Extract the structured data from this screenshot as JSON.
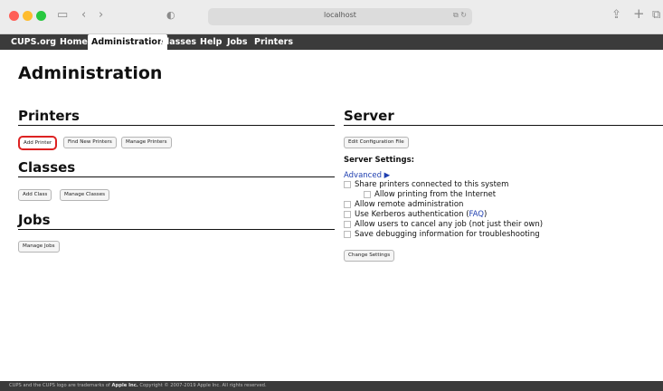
{
  "browser": {
    "url": "localhost",
    "translate_icon": "translate-icon",
    "reload_icon": "reload-icon"
  },
  "nav": {
    "brand": "CUPS.org",
    "items": [
      "Home",
      "Administration",
      "Classes",
      "Help",
      "Jobs",
      "Printers"
    ],
    "active": "Administration"
  },
  "page": {
    "title": "Administration"
  },
  "printers": {
    "heading": "Printers",
    "buttons": [
      "Add Printer",
      "Find New Printers",
      "Manage Printers"
    ]
  },
  "classes": {
    "heading": "Classes",
    "buttons": [
      "Add Class",
      "Manage Classes"
    ]
  },
  "jobs": {
    "heading": "Jobs",
    "buttons": [
      "Manage Jobs"
    ]
  },
  "server": {
    "heading": "Server",
    "edit_button": "Edit Configuration File",
    "settings_label": "Server Settings:",
    "advanced_link": "Advanced ▶",
    "options": [
      "Share printers connected to this system",
      "Allow printing from the Internet",
      "Allow remote administration",
      "Use Kerberos authentication (",
      "Allow users to cancel any job (not just their own)",
      "Save debugging information for troubleshooting"
    ],
    "faq_link": "FAQ",
    "faq_close": ")",
    "change_button": "Change Settings"
  },
  "footer": {
    "prefix": "CUPS and the CUPS logo are trademarks of ",
    "company": "Apple Inc.",
    "suffix": " Copyright © 2007-2019 Apple Inc. All rights reserved."
  },
  "colors": {
    "nav_bg": "#3b3b3b",
    "link": "#1f3fb0",
    "highlight": "#dd2222"
  }
}
